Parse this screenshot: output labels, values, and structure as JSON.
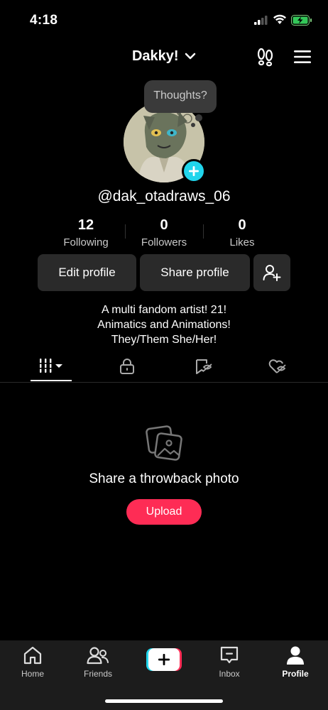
{
  "status_bar": {
    "time": "4:18"
  },
  "header": {
    "title": "Dakky!",
    "icons": [
      "chevron-down-icon",
      "footprints-icon",
      "menu-icon"
    ]
  },
  "profile": {
    "bubble_text": "Thoughts?",
    "username": "@dak_otadraws_06",
    "stats": [
      {
        "value": "12",
        "label": "Following"
      },
      {
        "value": "0",
        "label": "Followers"
      },
      {
        "value": "0",
        "label": "Likes"
      }
    ],
    "buttons": {
      "edit": "Edit profile",
      "share": "Share profile"
    },
    "bio": [
      "A multi fandom artist! 21!",
      "Animatics and Animations!",
      "They/Them She/Her!"
    ]
  },
  "tabs": [
    "videos-grid-icon",
    "lock-icon",
    "favorites-icon",
    "liked-icon"
  ],
  "empty_state": {
    "title": "Share a throwback photo",
    "button": "Upload"
  },
  "bottom_nav": [
    {
      "label": "Home",
      "icon": "home-icon"
    },
    {
      "label": "Friends",
      "icon": "friends-icon"
    },
    {
      "label": "Inbox",
      "icon": "inbox-icon"
    },
    {
      "label": "Profile",
      "icon": "profile-icon"
    }
  ],
  "colors": {
    "accent_cyan": "#20d5ec",
    "accent_red": "#fe2c55",
    "background": "#000000",
    "button_bg": "#2a2a2a"
  }
}
